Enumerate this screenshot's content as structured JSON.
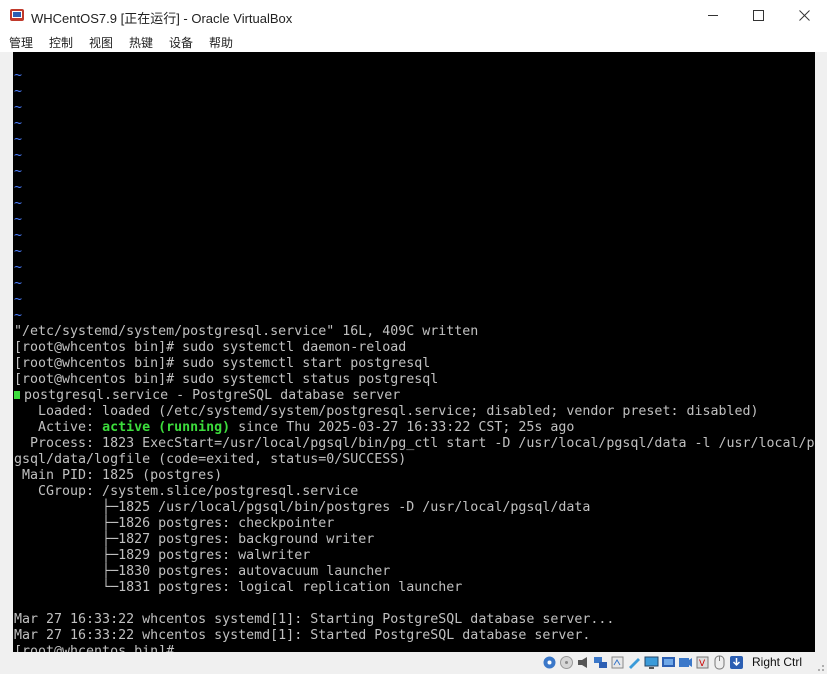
{
  "window": {
    "title": "WHCentOS7.9 [正在运行] - Oracle VirtualBox",
    "app_icon": "virtualbox-icon"
  },
  "menu": [
    "管理",
    "控制",
    "视图",
    "热键",
    "设备",
    "帮助"
  ],
  "terminal": {
    "tilde_count": 16,
    "tilde_char": "~",
    "lines": [
      "\"/etc/systemd/system/postgresql.service\" 16L, 409C written",
      "[root@whcentos bin]# sudo systemctl daemon-reload",
      "[root@whcentos bin]# sudo systemctl start postgresql",
      "[root@whcentos bin]# sudo systemctl status postgresql"
    ],
    "status": {
      "unit_line": "postgresql.service - PostgreSQL database server",
      "loaded": "   Loaded: loaded (/etc/systemd/system/postgresql.service; disabled; vendor preset: disabled)",
      "active_label": "   Active: ",
      "active_state": "active (running)",
      "active_rest": " since Thu 2025-03-27 16:33:22 CST; 25s ago",
      "process_1": "  Process: 1823 ExecStart=/usr/local/pgsql/bin/pg_ctl start -D /usr/local/pgsql/data -l /usr/local/p",
      "process_2": "gsql/data/logfile (code=exited, status=0/SUCCESS)",
      "main_pid": " Main PID: 1825 (postgres)",
      "cgroup": "   CGroup: /system.slice/postgresql.service",
      "tree": [
        "           ├─1825 /usr/local/pgsql/bin/postgres -D /usr/local/pgsql/data",
        "           ├─1826 postgres: checkpointer",
        "           ├─1827 postgres: background writer",
        "           ├─1829 postgres: walwriter",
        "           ├─1830 postgres: autovacuum launcher",
        "           └─1831 postgres: logical replication launcher"
      ]
    },
    "log": [
      "Mar 27 16:33:22 whcentos systemd[1]: Starting PostgreSQL database server...",
      "Mar 27 16:33:22 whcentos systemd[1]: Started PostgreSQL database server."
    ],
    "prompt": "[root@whcentos bin]# "
  },
  "statusbar": {
    "icons": [
      "hard-disk-icon",
      "optical-drive-icon",
      "audio-icon",
      "network-icon",
      "usb-icon",
      "shared-folder-icon",
      "display-icon",
      "video-capture-icon",
      "recording-icon",
      "cpu-icon",
      "mouse-integration-icon",
      "host-key-icon"
    ],
    "host_key": "Right Ctrl"
  },
  "colors": {
    "terminal_bg": "#000000",
    "terminal_fg": "#c0c0c0",
    "tilde": "#4c7fff",
    "active_green": "#3cdc3c"
  }
}
